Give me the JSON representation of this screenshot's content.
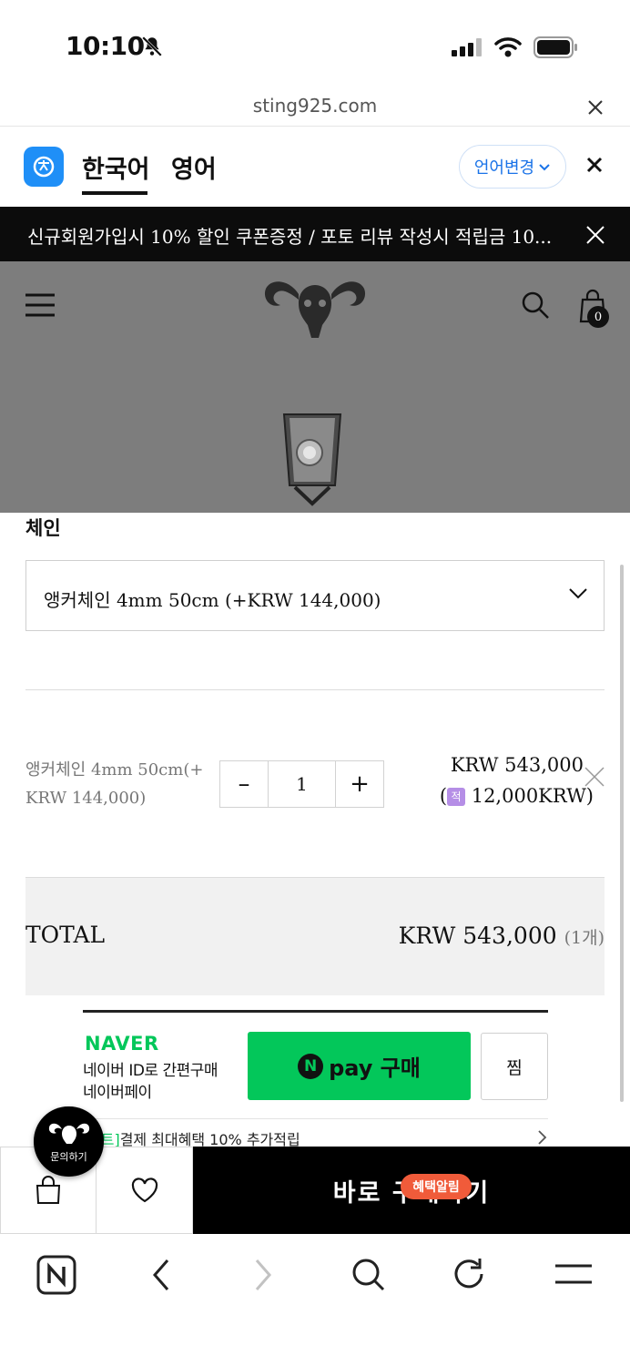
{
  "status_bar": {
    "time": "10:10"
  },
  "browser": {
    "url": "sting925.com"
  },
  "translate_bar": {
    "tab_korean": "한국어",
    "tab_english": "영어",
    "change_language": "언어변경"
  },
  "promo_banner": {
    "text": "신규회원가입시 10% 할인 쿠폰증정 / 포토 리뷰 작성시 적립금 10..."
  },
  "header": {
    "cart_count": "0"
  },
  "options": {
    "label": "체인",
    "selected": "앵커체인 4mm 50cm (+KRW 144,000)"
  },
  "selected_item": {
    "name": "앵커체인 4mm 50cm(+ KRW 144,000)",
    "quantity": "1",
    "decrement": "–",
    "increment": "+",
    "price": "KRW 543,000",
    "point_badge": "적",
    "point_amount": "12,000KRW)",
    "point_open": "("
  },
  "total": {
    "label": "TOTAL",
    "amount": "KRW 543,000",
    "count": "(1개)"
  },
  "naver_pay": {
    "brand": "NAVER",
    "desc_line1": "네이버 ID로 간편구매",
    "desc_line2": "네이버페이",
    "button_n": "N",
    "button_label": "pay 구매",
    "wish_label": "찜",
    "benefit_tag": "벤트]",
    "benefit_text": "결제 최대혜택 10% 추가적립"
  },
  "buy_bar": {
    "buy_label": "바로 구매하기",
    "benefit_alert": "혜택알림"
  },
  "inquiry": {
    "label": "문의하기"
  },
  "colors": {
    "accent_blue": "#1f8ff7",
    "naver_green": "#03c75a",
    "alert_orange": "#f05b3a"
  }
}
